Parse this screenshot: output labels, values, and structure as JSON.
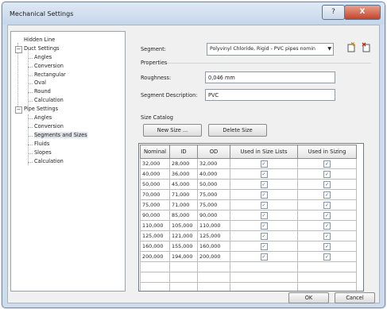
{
  "window": {
    "title": "Mechanical Settings",
    "help_icon": "?",
    "close_icon": "X"
  },
  "tree": {
    "items": [
      {
        "label": "Hidden Line"
      },
      {
        "label": "Duct Settings",
        "expander": "−"
      },
      {
        "label": "Angles"
      },
      {
        "label": "Conversion"
      },
      {
        "label": "Rectangular"
      },
      {
        "label": "Oval"
      },
      {
        "label": "Round"
      },
      {
        "label": "Calculation"
      },
      {
        "label": "Pipe Settings",
        "expander": "−"
      },
      {
        "label": "Angles"
      },
      {
        "label": "Conversion"
      },
      {
        "label": "Segments and Sizes"
      },
      {
        "label": "Fluids"
      },
      {
        "label": "Slopes"
      },
      {
        "label": "Calculation"
      }
    ],
    "selected_index": 11
  },
  "segment": {
    "label": "Segment:",
    "value": "Polyvinyl Chloride, Rigid - PVC pipes nomin",
    "new_icon": "new-segment-icon",
    "delete_icon": "delete-segment-icon"
  },
  "properties": {
    "heading": "Properties",
    "roughness_label": "Roughness:",
    "roughness_value": "0,046 mm",
    "description_label": "Segment Description:",
    "description_value": "PVC"
  },
  "catalog": {
    "heading": "Size Catalog",
    "new_size_button": "New Size ...",
    "delete_size_button": "Delete Size",
    "columns": [
      "Nominal",
      "ID",
      "OD",
      "Used in Size Lists",
      "Used in Sizing"
    ],
    "rows": [
      [
        "32,000",
        "28,000",
        "32,000",
        true,
        true
      ],
      [
        "40,000",
        "36,000",
        "40,000",
        true,
        true
      ],
      [
        "50,000",
        "45,000",
        "50,000",
        true,
        true
      ],
      [
        "70,000",
        "71,000",
        "75,000",
        true,
        true
      ],
      [
        "75,000",
        "71,000",
        "75,000",
        true,
        true
      ],
      [
        "90,000",
        "85,000",
        "90,000",
        true,
        true
      ],
      [
        "110,000",
        "105,000",
        "110,000",
        true,
        true
      ],
      [
        "125,000",
        "121,000",
        "125,000",
        true,
        true
      ],
      [
        "160,000",
        "155,000",
        "160,000",
        true,
        true
      ],
      [
        "200,000",
        "194,000",
        "200,000",
        true,
        true
      ]
    ]
  },
  "footer": {
    "ok_button": "OK",
    "cancel_button": "Cancel"
  }
}
